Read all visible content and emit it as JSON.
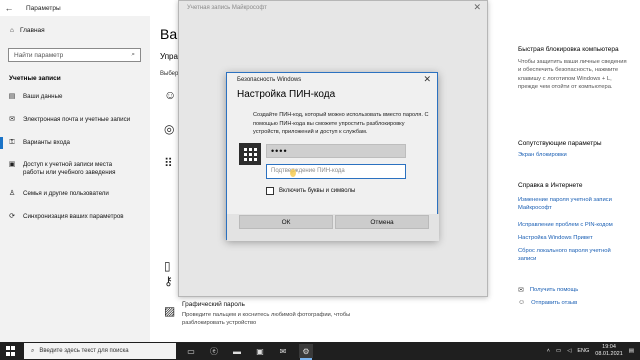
{
  "settings": {
    "window_title": "Параметры",
    "home": "Главная",
    "search_placeholder": "Найти параметр",
    "section": "Учетные записи",
    "nav": [
      {
        "label": "Ваши данные",
        "icon": "person-card-icon"
      },
      {
        "label": "Электронная почта и учетные записи",
        "icon": "envelope-icon"
      },
      {
        "label": "Варианты входа",
        "icon": "key-icon"
      },
      {
        "label": "Доступ к учетной записи места работы или учебного заведения",
        "icon": "briefcase-icon"
      },
      {
        "label": "Семья и другие пользователи",
        "icon": "family-icon"
      },
      {
        "label": "Синхронизация ваших параметров",
        "icon": "sync-icon"
      }
    ],
    "center": {
      "heading": "Вар",
      "subheading": "Упра",
      "sub": "Выбер",
      "picture_password_title": "Графический пароль",
      "picture_password_desc": "Проведите пальцем и коснитесь любимой фотографии, чтобы разблокировать устройство"
    },
    "right": {
      "dynamic_lock_title": "Быстрая блокировка компьютера",
      "dynamic_lock_text": "Чтобы защитить ваши личные сведения и обеспечить безопасность, нажмите клавишу с логотипом Windows + L, прежде чем отойти от компьютера.",
      "related_title": "Сопутствующие параметры",
      "related_link": "Экран блокировки",
      "help_title": "Справка в Интернете",
      "help_links": [
        "Изменение пароля учетной записи Майкрософт",
        "Исправление проблем с PIN-кодом",
        "Настройка Windows Привет",
        "Сброс локального пароля учетной записи"
      ],
      "get_help": "Получить помощь",
      "feedback": "Отправить отзыв"
    }
  },
  "ms_account": {
    "title": "Учетная запись Майкрософт"
  },
  "dialog": {
    "window_title": "Безопасность Windows",
    "heading": "Настройка ПИН-кода",
    "description": "Создайте ПИН-код, который можно использовать вместо пароля. С помощью ПИН-кода вы сможете упростить разблокировку устройств, приложений и доступ к службам.",
    "pin_value": "••••",
    "confirm_placeholder": "Подтверждение ПИН-кода",
    "checkbox_label": "Включить буквы и символы",
    "checkbox_checked": false,
    "ok": "ОК",
    "cancel": "Отмена"
  },
  "taskbar": {
    "search_placeholder": "Введите здесь текст для поиска",
    "language": "ENG",
    "time": "19:04",
    "date": "08.01.2021"
  }
}
